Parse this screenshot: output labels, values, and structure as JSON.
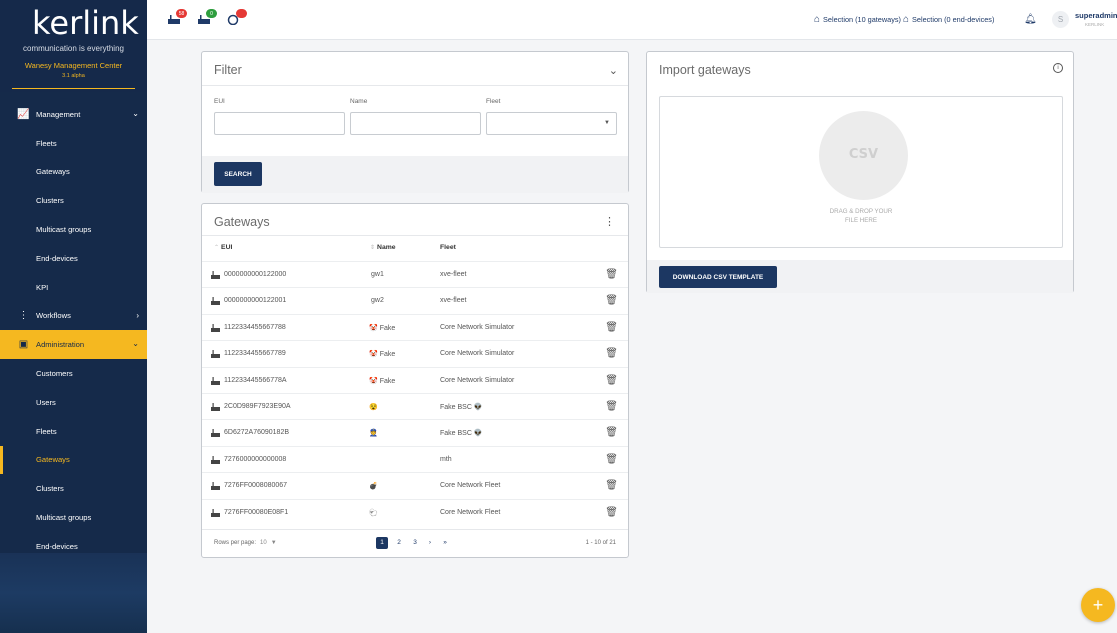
{
  "brand": {
    "logo": "kerlink",
    "tagline": "communication is everything",
    "app_name": "Wanesy Management Center",
    "version": "3.1 alpha"
  },
  "sidebar": {
    "management": {
      "label": "Management",
      "items": [
        "Fleets",
        "Gateways",
        "Clusters",
        "Multicast groups",
        "End-devices",
        "KPI"
      ]
    },
    "workflows": {
      "label": "Workflows"
    },
    "administration": {
      "label": "Administration",
      "items": [
        "Customers",
        "Users",
        "Fleets",
        "Gateways",
        "Clusters",
        "Multicast groups",
        "End-devices"
      ]
    }
  },
  "topbar": {
    "badges": [
      "58",
      "0",
      ""
    ],
    "selection_gateways": "Selection (10 gateways)",
    "selection_devices": "Selection (0 end-devices)",
    "avatar_initial": "S",
    "user": "superadmin",
    "org": "KERLINK"
  },
  "filter": {
    "title": "Filter",
    "eui_label": "EUI",
    "name_label": "Name",
    "fleet_label": "Fleet",
    "search_label": "SEARCH"
  },
  "gateways": {
    "title": "Gateways",
    "columns": {
      "eui": "EUI",
      "name": "Name",
      "fleet": "Fleet"
    },
    "rows": [
      {
        "eui": "0000000000122000",
        "name": "gw1",
        "fleet": "xve-fleet",
        "name_icon": "",
        "fleet_icon": ""
      },
      {
        "eui": "0000000000122001",
        "name": "gw2",
        "fleet": "xve-fleet",
        "name_icon": "",
        "fleet_icon": ""
      },
      {
        "eui": "1122334455667788",
        "name": "Fake",
        "fleet": "Core Network Simulator",
        "name_icon": "🤡",
        "fleet_icon": ""
      },
      {
        "eui": "1122334455667789",
        "name": "Fake",
        "fleet": "Core Network Simulator",
        "name_icon": "🤡",
        "fleet_icon": ""
      },
      {
        "eui": "112233445566778A",
        "name": "Fake",
        "fleet": "Core Network Simulator",
        "name_icon": "🤡",
        "fleet_icon": ""
      },
      {
        "eui": "2C0D989F7923E90A",
        "name": "",
        "fleet": "Fake BSC",
        "name_icon": "😵",
        "fleet_icon": "👽"
      },
      {
        "eui": "6D6272A76090182B",
        "name": "",
        "fleet": "Fake BSC",
        "name_icon": "👮",
        "fleet_icon": "👽"
      },
      {
        "eui": "7276000000000008",
        "name": "",
        "fleet": "mth",
        "name_icon": "",
        "fleet_icon": ""
      },
      {
        "eui": "7276FF0008080067",
        "name": "",
        "fleet": "Core Network Fleet",
        "name_icon": "💣",
        "fleet_icon": ""
      },
      {
        "eui": "7276FF00080E08F1",
        "name": "",
        "fleet": "Core Network Fleet",
        "name_icon": "🐑",
        "fleet_icon": ""
      }
    ],
    "rows_per_page_label": "Rows per page:",
    "rows_per_page": "10",
    "pages": [
      "1",
      "2",
      "3"
    ],
    "next": "›",
    "last": "»",
    "range": "1 - 10 of 21"
  },
  "import": {
    "title": "Import gateways",
    "csv": "CSV",
    "drop_line1": "DRAG & DROP YOUR",
    "drop_line2": "FILE HERE",
    "download_label": "DOWNLOAD CSV TEMPLATE"
  },
  "fab": "+",
  "colors": {
    "navy": "#152a4a",
    "accent": "#f5b820",
    "button": "#1c3762"
  }
}
